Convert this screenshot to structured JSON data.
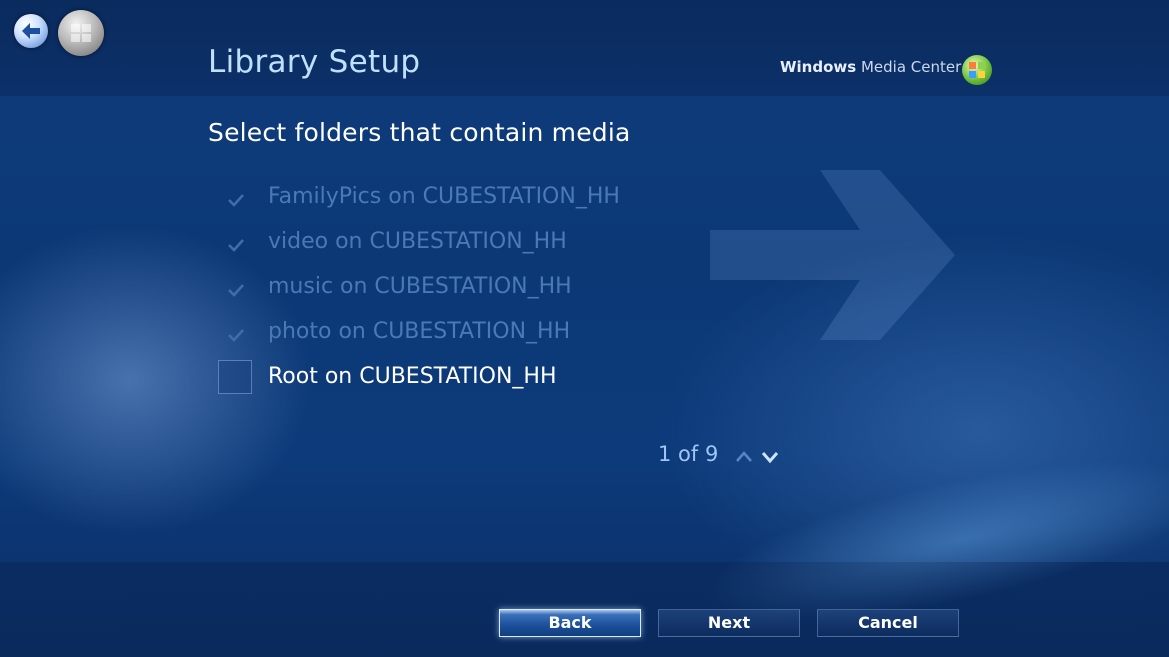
{
  "header": {
    "page_title": "Library Setup",
    "brand_bold": "Windows",
    "brand_rest": " Media Center"
  },
  "main": {
    "heading": "Select folders that contain media",
    "folders": [
      {
        "label": "FamilyPics on CUBESTATION_HH",
        "checked": true
      },
      {
        "label": "video on CUBESTATION_HH",
        "checked": true
      },
      {
        "label": "music on CUBESTATION_HH",
        "checked": true
      },
      {
        "label": "photo on CUBESTATION_HH",
        "checked": true
      },
      {
        "label": "Root on CUBESTATION_HH",
        "checked": false
      }
    ],
    "pager": "1 of 9"
  },
  "footer": {
    "back_label": "Back",
    "next_label": "Next",
    "cancel_label": "Cancel"
  },
  "icons": {
    "back": "back-arrow-icon",
    "start": "windows-start-orb-icon",
    "brand": "media-center-logo-icon",
    "check": "checkmark-icon",
    "up": "chevron-up-icon",
    "down": "chevron-down-icon"
  },
  "colors": {
    "title": "#bfe0ff",
    "checked_text": "#4a79b6",
    "unchecked_text": "#ffffff",
    "pager": "#9cc6f5"
  }
}
